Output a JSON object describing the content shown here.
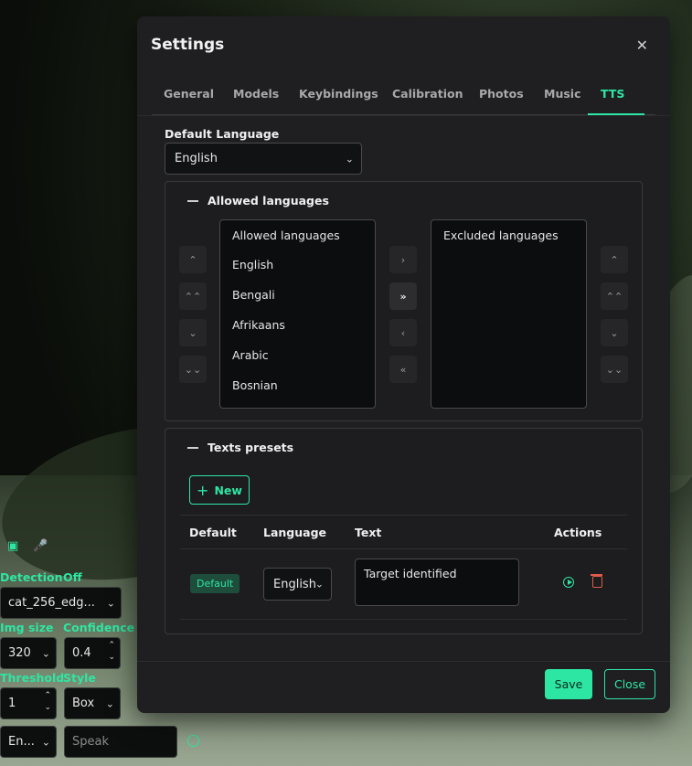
{
  "colors": {
    "accent": "#2ee6a3",
    "danger": "#e05a4a",
    "modal_bg": "#1f1f21"
  },
  "modal": {
    "title": "Settings",
    "close_icon": "close-icon",
    "tabs": [
      "General",
      "Models",
      "Keybindings",
      "Calibration",
      "Photos",
      "Music",
      "TTS"
    ],
    "active_tab": "TTS"
  },
  "tts": {
    "default_language_label": "Default Language",
    "default_language_value": "English",
    "allowed_panel": {
      "title": "Allowed languages",
      "left_list": [
        "Allowed languages",
        "English",
        "Bengali",
        "Afrikaans",
        "Arabic",
        "Bosnian"
      ],
      "right_list": [
        "Excluded languages"
      ],
      "move_buttons": [
        "›",
        "»",
        "‹",
        "«"
      ]
    },
    "presets_panel": {
      "title": "Texts presets",
      "new_button": "New",
      "columns": [
        "Default",
        "Language",
        "Text",
        "Actions"
      ],
      "rows": [
        {
          "default_badge": "Default",
          "language": "English",
          "text": "Target identified"
        }
      ]
    }
  },
  "footer": {
    "save": "Save",
    "close": "Close"
  },
  "overlay": {
    "detection_label": "Detection",
    "detection_state": "Off",
    "model_value": "cat_256_edg...",
    "img_size_label": "Img size",
    "img_size_value": "320",
    "confidence_label": "Confidence",
    "confidence_value": "0.4",
    "threshold_label": "Threshold",
    "threshold_value": "1",
    "style_label": "Style",
    "style_value": "Box",
    "lang_value": "En...",
    "speak_placeholder": "Speak"
  }
}
